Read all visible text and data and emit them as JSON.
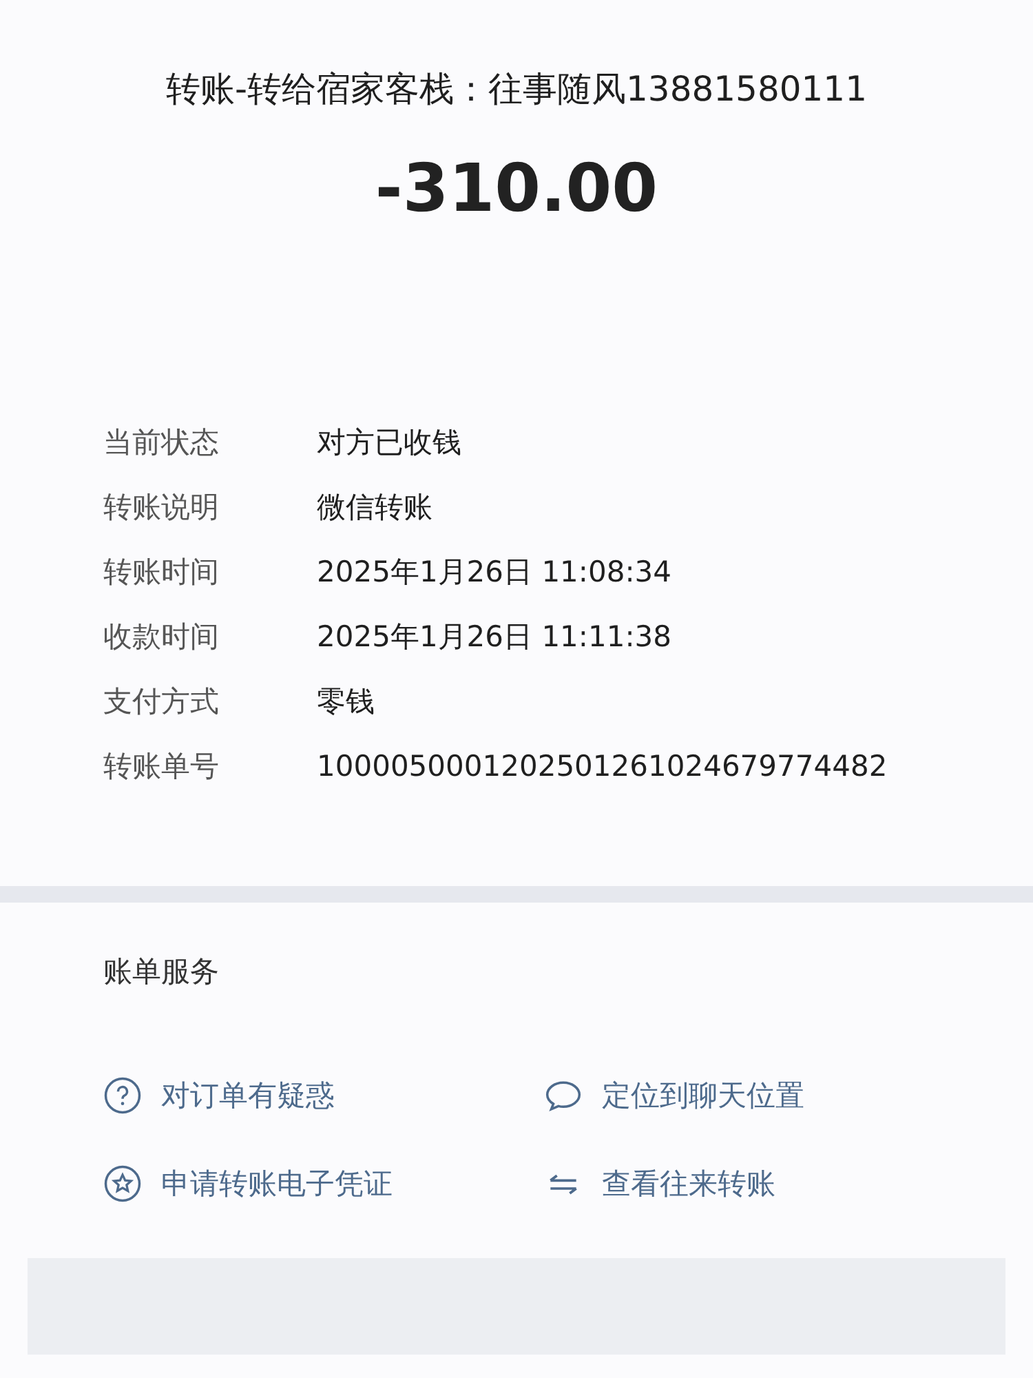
{
  "header": {
    "title": "转账-转给宿家客栈：往事随风13881580111",
    "amount": "-310.00"
  },
  "details": [
    {
      "label": "当前状态",
      "value": "对方已收钱"
    },
    {
      "label": "转账说明",
      "value": "微信转账"
    },
    {
      "label": "转账时间",
      "value": "2025年1月26日 11:08:34"
    },
    {
      "label": "收款时间",
      "value": "2025年1月26日 11:11:38"
    },
    {
      "label": "支付方式",
      "value": "零钱"
    },
    {
      "label": "转账单号",
      "value": "1000050001202501261024679774482"
    }
  ],
  "services": {
    "title": "账单服务",
    "items": [
      {
        "kind": "question",
        "label": "对订单有疑惑"
      },
      {
        "kind": "chat",
        "label": "定位到聊天位置"
      },
      {
        "kind": "star",
        "label": "申请转账电子凭证"
      },
      {
        "kind": "swap",
        "label": "查看往来转账"
      }
    ]
  }
}
